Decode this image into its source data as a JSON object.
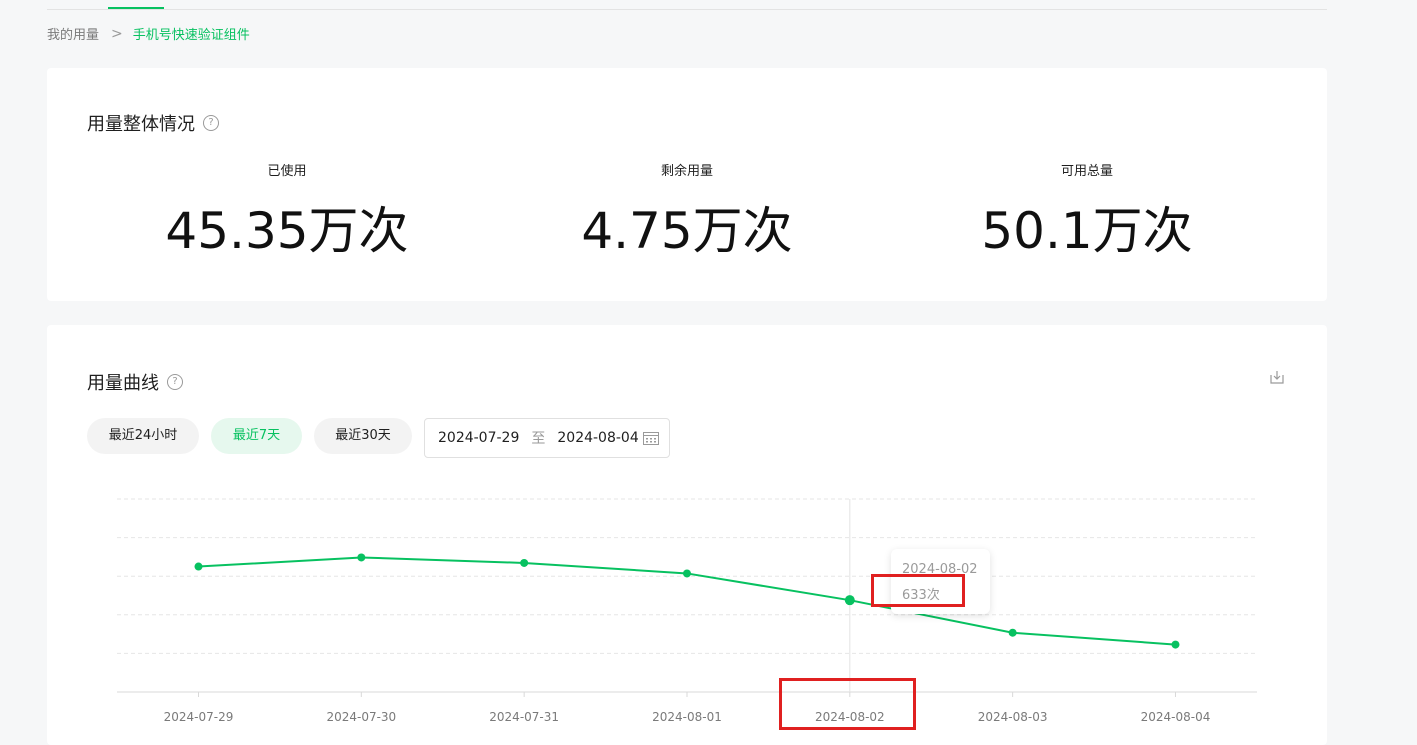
{
  "breadcrumb": {
    "parent": "我的用量",
    "separator": ">",
    "current": "手机号快速验证组件"
  },
  "overview": {
    "title": "用量整体情况",
    "stats": [
      {
        "label": "已使用",
        "value": "45.35万次"
      },
      {
        "label": "剩余用量",
        "value": "4.75万次"
      },
      {
        "label": "可用总量",
        "value": "50.1万次"
      }
    ]
  },
  "curve": {
    "title": "用量曲线",
    "ranges": [
      "最近24小时",
      "最近7天",
      "最近30天"
    ],
    "active_range": "最近7天",
    "date_start": "2024-07-29",
    "date_to": "至",
    "date_end": "2024-08-04"
  },
  "tooltip": {
    "date": "2024-08-02",
    "value": "633次"
  },
  "colors": {
    "accent": "#07c160",
    "highlight": "#e02020"
  },
  "chart_data": {
    "type": "line",
    "categories": [
      "2024-07-29",
      "2024-07-30",
      "2024-07-31",
      "2024-08-01",
      "2024-08-02",
      "2024-08-03",
      "2024-08-04"
    ],
    "series": [
      {
        "values": [
          755,
          788,
          768,
          730,
          633,
          515,
          472
        ]
      }
    ],
    "ylim": [
      300,
      1000
    ],
    "grid": true,
    "hovered_index": 4
  }
}
